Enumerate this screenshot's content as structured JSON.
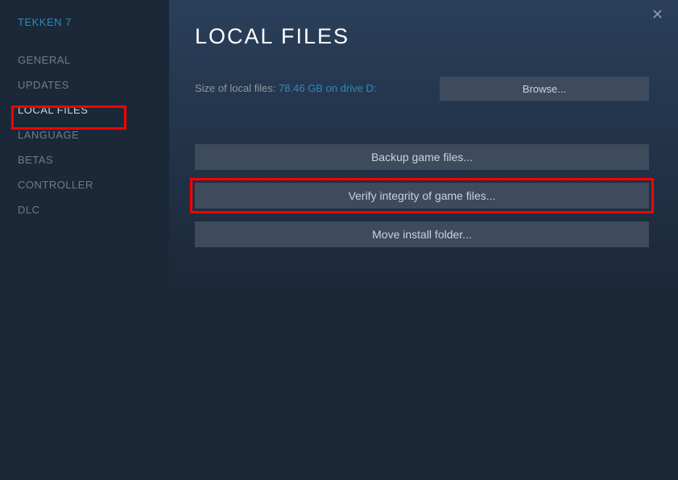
{
  "sidebar": {
    "title": "TEKKEN 7",
    "items": [
      {
        "label": "GENERAL"
      },
      {
        "label": "UPDATES"
      },
      {
        "label": "LOCAL FILES"
      },
      {
        "label": "LANGUAGE"
      },
      {
        "label": "BETAS"
      },
      {
        "label": "CONTROLLER"
      },
      {
        "label": "DLC"
      }
    ]
  },
  "main": {
    "title": "LOCAL FILES",
    "size_label": "Size of local files: ",
    "size_value": "78.46 GB on drive D:",
    "browse_label": "Browse...",
    "backup_label": "Backup game files...",
    "verify_label": "Verify integrity of game files...",
    "move_label": "Move install folder..."
  },
  "close_label": "✕"
}
